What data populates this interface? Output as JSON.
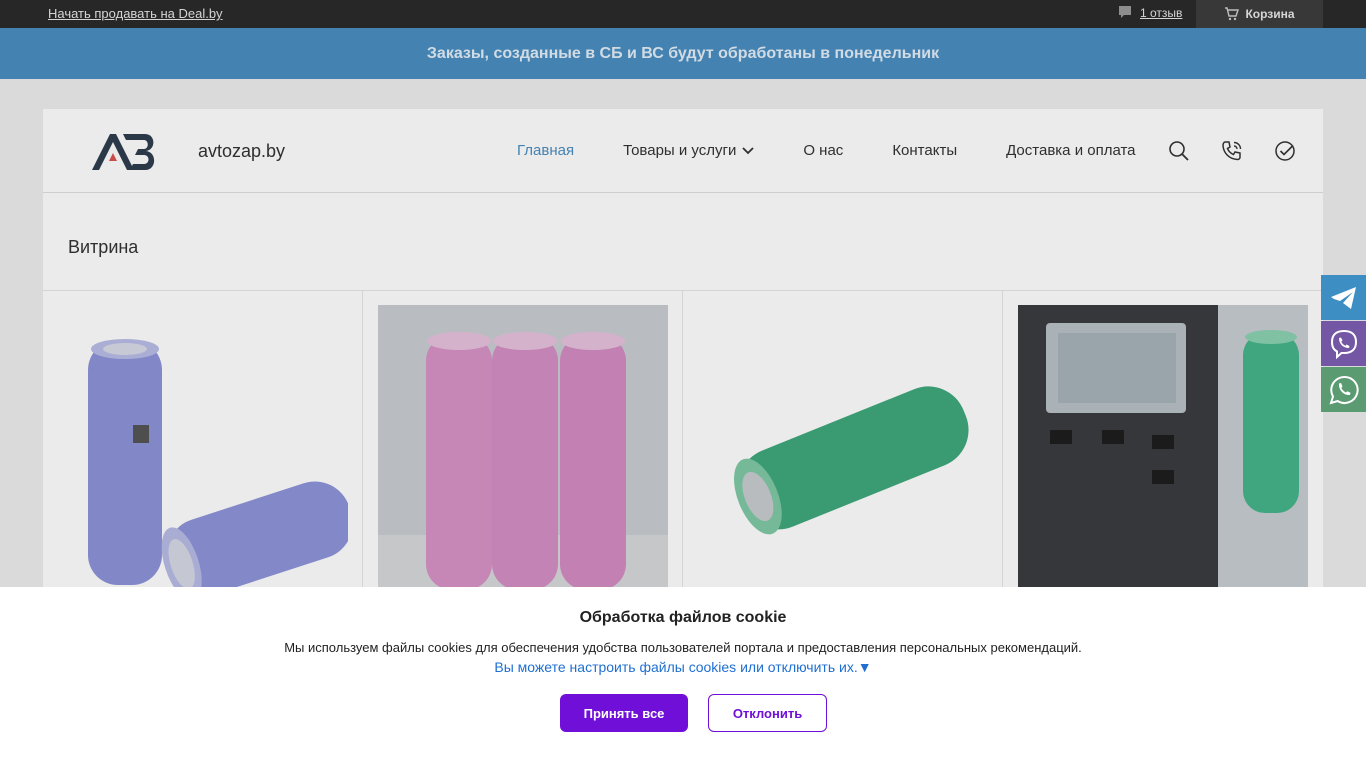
{
  "topbar": {
    "sell_link": "Начать продавать на Deal.by",
    "reviews_link": "1 отзыв",
    "cart_label": "Корзина"
  },
  "banner": {
    "text": "Заказы, созданные в СБ и ВС будут обработаны в понедельник"
  },
  "header": {
    "site_name": "avtozap.by",
    "nav": {
      "home": "Главная",
      "products": "Товары и услуги",
      "about": "О нас",
      "contacts": "Контакты",
      "delivery": "Доставка и оплата"
    },
    "icons": [
      "search-icon",
      "phone-icon",
      "check-circle-icon"
    ]
  },
  "showcase": {
    "title": "Витрина"
  },
  "social": [
    "telegram-icon",
    "viber-icon",
    "whatsapp-icon"
  ],
  "cookie": {
    "title": "Обработка файлов cookie",
    "text": "Мы используем файлы cookies для обеспечения удобства пользователей портала и предоставления персональных рекомендаций.",
    "settings_link": "Вы можете настроить файлы cookies или отключить их.▼",
    "accept_label": "Принять все",
    "decline_label": "Отклонить"
  },
  "colors": {
    "topbar": "#2b2b2b",
    "banner": "#4a8ec2",
    "accent": "#6f0fd8",
    "nav_active": "#4a8ec2"
  }
}
